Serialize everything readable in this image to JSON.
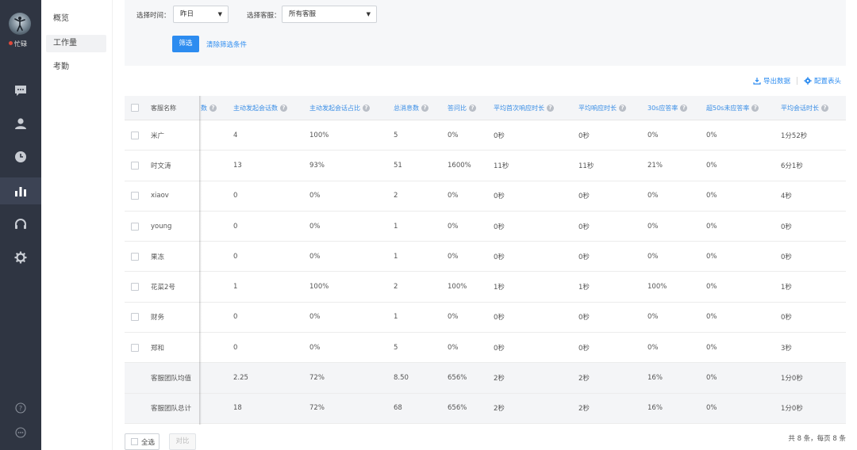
{
  "rail": {
    "status": "忙碌",
    "icons": [
      "chat-icon",
      "user-icon",
      "clock-icon",
      "bar-chart-icon",
      "headset-icon",
      "settings-icon"
    ],
    "bottom_icons": [
      "help-icon",
      "more-icon"
    ],
    "active_color": "#3c4354"
  },
  "submenu": {
    "items": [
      {
        "label": "概览"
      },
      {
        "label": "工作量"
      },
      {
        "label": "考勤"
      }
    ],
    "active_index": 1
  },
  "filter": {
    "time_label": "选择时间：",
    "time_value": "昨日",
    "agent_label": "选择客服：",
    "agent_value": "所有客服",
    "filter_button": "筛选",
    "clear_link": "清除筛选条件",
    "accent": "#2d8cf0"
  },
  "toolbar": {
    "export": "导出数据",
    "config_header": "配置表头"
  },
  "table": {
    "columns": [
      "客服名称",
      "数",
      "主动发起会话数",
      "主动发起会话占比",
      "总消息数",
      "答问比",
      "平均首次响应时长",
      "平均响应时长",
      "30s应答率",
      "超50s未应答率",
      "平均会话时长"
    ],
    "rows": [
      [
        "米广",
        "4",
        "100%",
        "5",
        "0%",
        "0秒",
        "0秒",
        "0%",
        "0%",
        "1分52秒"
      ],
      [
        "时文涛",
        "13",
        "93%",
        "51",
        "1600%",
        "11秒",
        "11秒",
        "21%",
        "0%",
        "6分1秒"
      ],
      [
        "xiaov",
        "0",
        "0%",
        "2",
        "0%",
        "0秒",
        "0秒",
        "0%",
        "0%",
        "4秒"
      ],
      [
        "young",
        "0",
        "0%",
        "1",
        "0%",
        "0秒",
        "0秒",
        "0%",
        "0%",
        "0秒"
      ],
      [
        "果冻",
        "0",
        "0%",
        "1",
        "0%",
        "0秒",
        "0秒",
        "0%",
        "0%",
        "0秒"
      ],
      [
        "花菜2号",
        "1",
        "100%",
        "2",
        "100%",
        "1秒",
        "1秒",
        "100%",
        "0%",
        "1秒"
      ],
      [
        "财务",
        "0",
        "0%",
        "1",
        "0%",
        "0秒",
        "0秒",
        "0%",
        "0%",
        "0秒"
      ],
      [
        "郑和",
        "0",
        "0%",
        "5",
        "0%",
        "0秒",
        "0秒",
        "0%",
        "0%",
        "3秒"
      ]
    ],
    "summary_rows": [
      [
        "客服团队均值",
        "2.25",
        "72%",
        "8.50",
        "656%",
        "2秒",
        "2秒",
        "16%",
        "0%",
        "1分0秒"
      ],
      [
        "客服团队总计",
        "18",
        "72%",
        "68",
        "656%",
        "2秒",
        "2秒",
        "16%",
        "0%",
        "1分0秒"
      ]
    ]
  },
  "footer": {
    "select_all": "全选",
    "compare": "对比",
    "pagination": "共 8 条，每页 8 条"
  }
}
